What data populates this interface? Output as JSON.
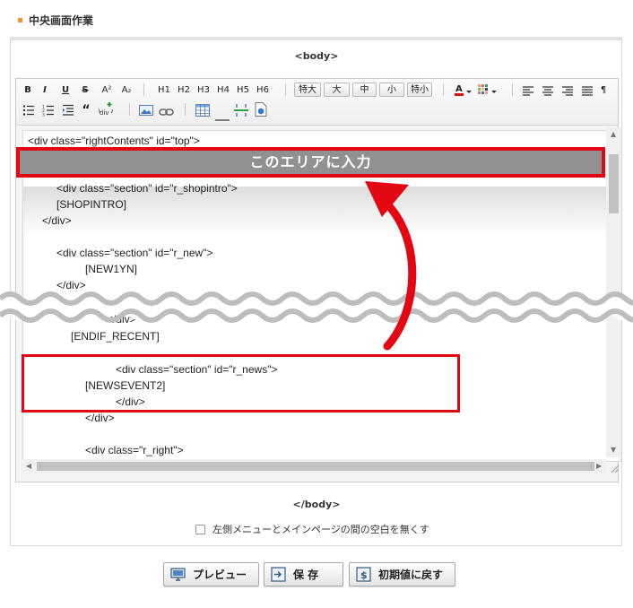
{
  "section_title": "中央画面作業",
  "body_open": "<body>",
  "body_close": "</body>",
  "toolbar": {
    "format_buttons": [
      "B",
      "I",
      "U",
      "S",
      "A²",
      "A₂"
    ],
    "heading_buttons": [
      "H1",
      "H2",
      "H3",
      "H4",
      "H5",
      "H6"
    ],
    "size_buttons": [
      "特大",
      "大",
      "中",
      "小",
      "特小"
    ],
    "quote_label": "“",
    "div_label": "div"
  },
  "code_lines": {
    "l1": "<div class=\"rightContents\" id=\"top\">",
    "l2": "<div class=\"section\" id=\"r_shopintro\">",
    "l3": "[SHOPINTRO]",
    "l4": "</div>",
    "l5": "<div class=\"section\" id=\"r_new\">",
    "l6": "[NEW1YN]",
    "l7": "</div>",
    "l8": "</div>",
    "l9": "[ENDIF_RECENT]",
    "l10": "<div class=\"section\" id=\"r_news\">",
    "l11": "[NEWSEVENT2]",
    "l12": "</div>",
    "l13": "</div>",
    "l14": "<div class=\"r_right\">"
  },
  "banner_text": "このエリアに入力",
  "checkbox_label": "左側メニューとメインページの間の空白を無くす",
  "buttons": {
    "preview": "プレビュー",
    "save": "保 存",
    "reset": "初期値に戻す"
  },
  "colors": {
    "highlight_red": "#e30613",
    "accent_orange": "#f0922b"
  }
}
